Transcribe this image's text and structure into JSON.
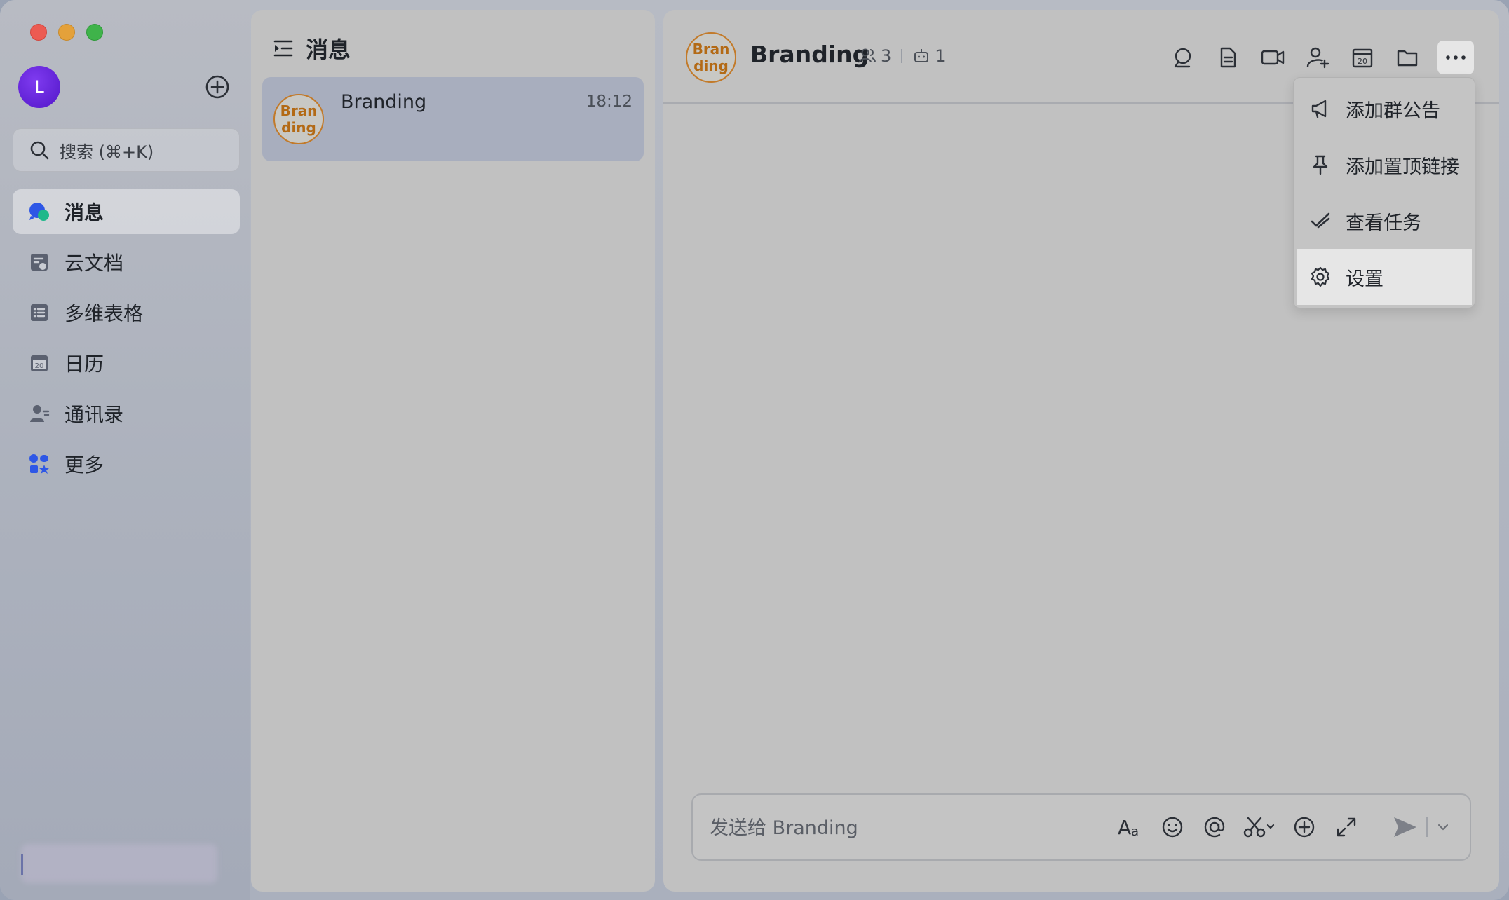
{
  "user": {
    "avatar_letter": "L"
  },
  "search": {
    "placeholder": "搜索 (⌘+K)"
  },
  "nav": {
    "items": [
      {
        "label": "消息",
        "icon": "message-icon",
        "active": true
      },
      {
        "label": "云文档",
        "icon": "cloud-doc-icon"
      },
      {
        "label": "多维表格",
        "icon": "base-table-icon"
      },
      {
        "label": "日历",
        "icon": "calendar-icon"
      },
      {
        "label": "通讯录",
        "icon": "contacts-icon"
      },
      {
        "label": "更多",
        "icon": "apps-icon"
      }
    ]
  },
  "list": {
    "title": "消息",
    "conversations": [
      {
        "name": "Branding",
        "time": "18:12",
        "avatar_line1": "Bran",
        "avatar_line2": "ding"
      }
    ]
  },
  "chat": {
    "title": "Branding",
    "avatar_line1": "Bran",
    "avatar_line2": "ding",
    "member_count": "3",
    "bot_count": "1",
    "input_placeholder": "发送给 Branding"
  },
  "menu": {
    "items": [
      {
        "label": "添加群公告",
        "icon": "megaphone-icon"
      },
      {
        "label": "添加置顶链接",
        "icon": "pin-icon"
      },
      {
        "label": "查看任务",
        "icon": "task-check-icon"
      },
      {
        "label": "设置",
        "icon": "gear-icon",
        "highlighted": true
      }
    ]
  },
  "colors": {
    "accent_purple": "#6a22dc",
    "brand_avatar": "#b36a15",
    "active_bg": "#a8aebe"
  }
}
